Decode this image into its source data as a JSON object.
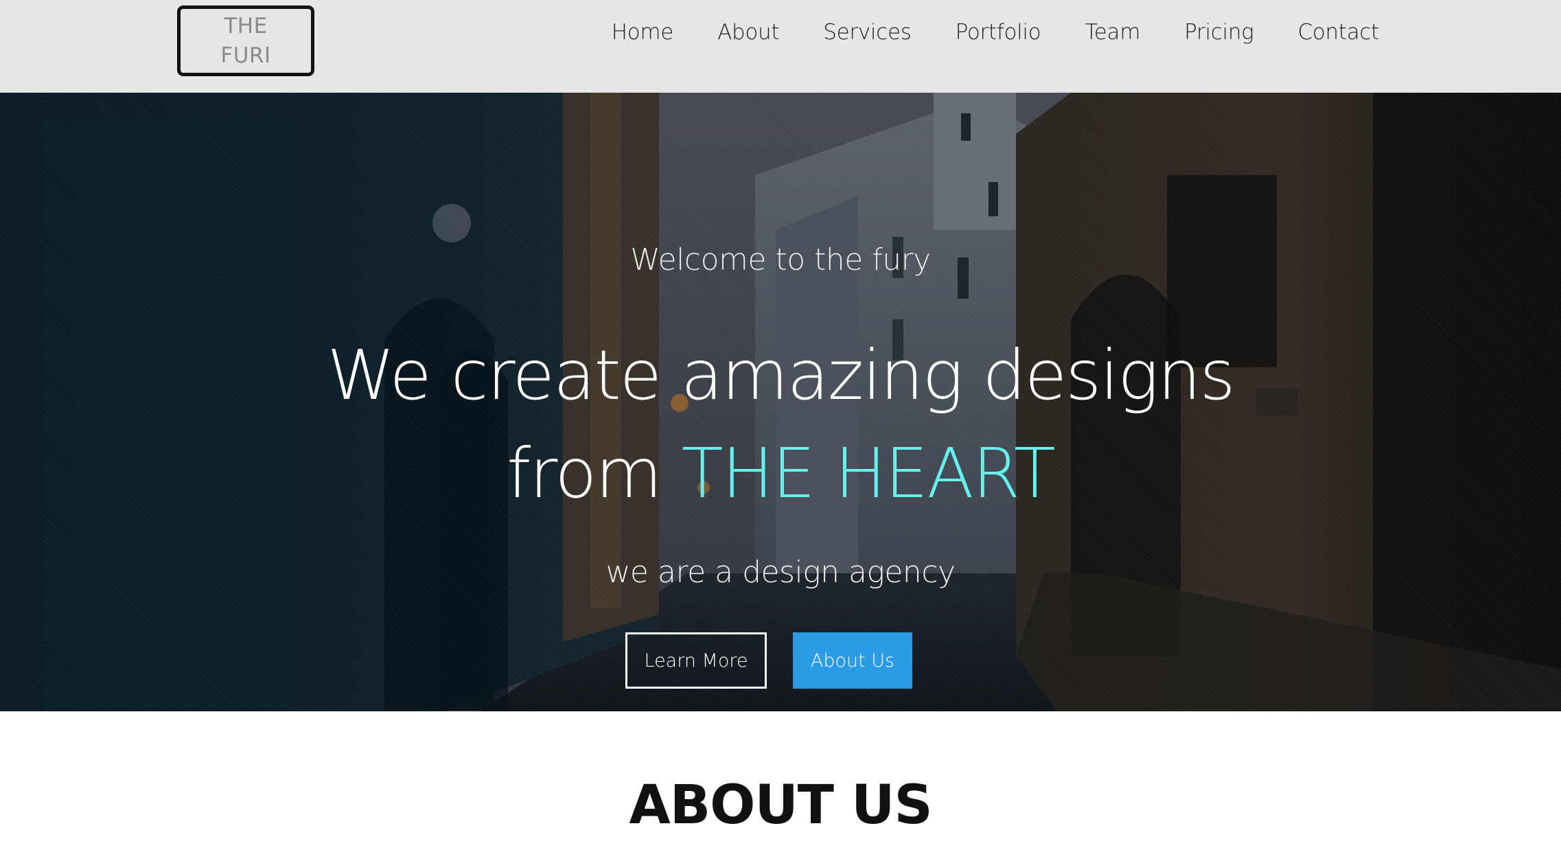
{
  "logo": {
    "line1": "THE",
    "line2": "FURI"
  },
  "nav": {
    "items": [
      {
        "label": "Home"
      },
      {
        "label": "About"
      },
      {
        "label": "Services"
      },
      {
        "label": "Portfolio"
      },
      {
        "label": "Team"
      },
      {
        "label": "Pricing"
      },
      {
        "label": "Contact"
      }
    ]
  },
  "hero": {
    "welcome": "Welcome to the fury",
    "title_line1": "We create amazing designs",
    "title_line2_prefix": "from",
    "title_line2_accent": "THE HEART",
    "subtitle": "we are a design agency",
    "learn_more_label": "Learn More",
    "about_us_label": "About Us"
  },
  "about": {
    "title": "ABOUT US"
  },
  "colors": {
    "accent": "#66f0ee",
    "primary_button": "#2b9be6",
    "navbar_bg": "#e6e6e6"
  }
}
